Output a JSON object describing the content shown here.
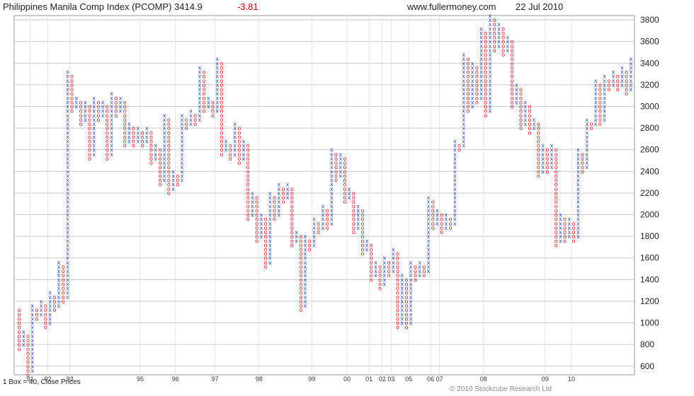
{
  "header": {
    "title": "Philippines Manila Comp Index (PCOMP) 3414.9",
    "change": "-3.81",
    "site": "www.fullermoney.com",
    "date": "22 Jul 2010"
  },
  "footer": {
    "box_info": "1 Box = 40, Close Prices",
    "copyright": "© 2010 Stockcube Research Ltd"
  },
  "colors": {
    "x_column": "#1f3fbf",
    "o_column": "#cc1111",
    "grid": "#c8c8c8"
  },
  "chart_data": {
    "type": "point-and-figure",
    "box_size": 40,
    "ylim": [
      520,
      3840
    ],
    "yticks": [
      600,
      800,
      1000,
      1200,
      1400,
      1600,
      1800,
      2000,
      2200,
      2400,
      2600,
      2800,
      3000,
      3200,
      3400,
      3600,
      3800
    ],
    "grid": true,
    "x_year_labels": [
      {
        "label": "91",
        "col": 3
      },
      {
        "label": "92",
        "col": 7
      },
      {
        "label": "93",
        "col": 12
      },
      {
        "label": "95",
        "col": 28
      },
      {
        "label": "96",
        "col": 36
      },
      {
        "label": "97",
        "col": 45
      },
      {
        "label": "98",
        "col": 55
      },
      {
        "label": "99",
        "col": 67
      },
      {
        "label": "00",
        "col": 75
      },
      {
        "label": "01",
        "col": 80
      },
      {
        "label": "02",
        "col": 83
      },
      {
        "label": "03",
        "col": 85
      },
      {
        "label": "05",
        "col": 89
      },
      {
        "label": "06",
        "col": 94
      },
      {
        "label": "07",
        "col": 96
      },
      {
        "label": "08",
        "col": 106
      },
      {
        "label": "09",
        "col": 120
      },
      {
        "label": "10",
        "col": 126
      }
    ],
    "columns": [
      {
        "t": "O",
        "from": 1120,
        "to": 760
      },
      {
        "t": "X",
        "from": 800,
        "to": 920
      },
      {
        "t": "O",
        "from": 880,
        "to": 520
      },
      {
        "t": "X",
        "from": 560,
        "to": 1160
      },
      {
        "t": "O",
        "from": 1120,
        "to": 1040
      },
      {
        "t": "X",
        "from": 1080,
        "to": 1200
      },
      {
        "t": "O",
        "from": 1160,
        "to": 960
      },
      {
        "t": "X",
        "from": 1000,
        "to": 1280
      },
      {
        "t": "O",
        "from": 1240,
        "to": 1120
      },
      {
        "t": "X",
        "from": 1160,
        "to": 1560
      },
      {
        "t": "O",
        "from": 1520,
        "to": 1200
      },
      {
        "t": "X",
        "from": 1240,
        "to": 3320
      },
      {
        "t": "O",
        "from": 3280,
        "to": 2960
      },
      {
        "t": "X",
        "from": 3000,
        "to": 3080
      },
      {
        "t": "O",
        "from": 3040,
        "to": 2840
      },
      {
        "t": "X",
        "from": 2880,
        "to": 3040
      },
      {
        "t": "O",
        "from": 3000,
        "to": 2520
      },
      {
        "t": "X",
        "from": 2560,
        "to": 3080
      },
      {
        "t": "O",
        "from": 3040,
        "to": 2880
      },
      {
        "t": "X",
        "from": 2920,
        "to": 3040
      },
      {
        "t": "O",
        "from": 3000,
        "to": 2520
      },
      {
        "t": "X",
        "from": 2560,
        "to": 3120
      },
      {
        "t": "O",
        "from": 3080,
        "to": 2920
      },
      {
        "t": "X",
        "from": 2960,
        "to": 3080
      },
      {
        "t": "O",
        "from": 3040,
        "to": 2640
      },
      {
        "t": "X",
        "from": 2680,
        "to": 2840
      },
      {
        "t": "O",
        "from": 2800,
        "to": 2640
      },
      {
        "t": "X",
        "from": 2680,
        "to": 2800
      },
      {
        "t": "O",
        "from": 2760,
        "to": 2640
      },
      {
        "t": "X",
        "from": 2680,
        "to": 2800
      },
      {
        "t": "O",
        "from": 2760,
        "to": 2480
      },
      {
        "t": "X",
        "from": 2520,
        "to": 2640
      },
      {
        "t": "O",
        "from": 2600,
        "to": 2280
      },
      {
        "t": "X",
        "from": 2320,
        "to": 2920
      },
      {
        "t": "O",
        "from": 2880,
        "to": 2200
      },
      {
        "t": "X",
        "from": 2240,
        "to": 2400
      },
      {
        "t": "O",
        "from": 2360,
        "to": 2280
      },
      {
        "t": "X",
        "from": 2320,
        "to": 2920
      },
      {
        "t": "O",
        "from": 2880,
        "to": 2800
      },
      {
        "t": "X",
        "from": 2840,
        "to": 2960
      },
      {
        "t": "O",
        "from": 2920,
        "to": 2840
      },
      {
        "t": "X",
        "from": 2880,
        "to": 3360
      },
      {
        "t": "O",
        "from": 3320,
        "to": 2960
      },
      {
        "t": "X",
        "from": 3000,
        "to": 3080
      },
      {
        "t": "O",
        "from": 3040,
        "to": 2920
      },
      {
        "t": "X",
        "from": 2960,
        "to": 3440
      },
      {
        "t": "O",
        "from": 3400,
        "to": 2560
      },
      {
        "t": "X",
        "from": 2600,
        "to": 2680
      },
      {
        "t": "O",
        "from": 2640,
        "to": 2520
      },
      {
        "t": "X",
        "from": 2560,
        "to": 2840
      },
      {
        "t": "O",
        "from": 2800,
        "to": 2480
      },
      {
        "t": "X",
        "from": 2520,
        "to": 2680
      },
      {
        "t": "O",
        "from": 2640,
        "to": 1960
      },
      {
        "t": "X",
        "from": 2000,
        "to": 2200
      },
      {
        "t": "O",
        "from": 2160,
        "to": 1760
      },
      {
        "t": "X",
        "from": 1800,
        "to": 2000
      },
      {
        "t": "O",
        "from": 1960,
        "to": 1520
      },
      {
        "t": "X",
        "from": 1560,
        "to": 2200
      },
      {
        "t": "O",
        "from": 2160,
        "to": 1960
      },
      {
        "t": "X",
        "from": 2000,
        "to": 2280
      },
      {
        "t": "O",
        "from": 2240,
        "to": 2120
      },
      {
        "t": "X",
        "from": 2160,
        "to": 2280
      },
      {
        "t": "O",
        "from": 2240,
        "to": 1720
      },
      {
        "t": "X",
        "from": 1760,
        "to": 1840
      },
      {
        "t": "O",
        "from": 1800,
        "to": 1120
      },
      {
        "t": "X",
        "from": 1160,
        "to": 1800
      },
      {
        "t": "O",
        "from": 1760,
        "to": 1680
      },
      {
        "t": "X",
        "from": 1720,
        "to": 1960
      },
      {
        "t": "O",
        "from": 1920,
        "to": 1840
      },
      {
        "t": "X",
        "from": 1880,
        "to": 2080
      },
      {
        "t": "O",
        "from": 2040,
        "to": 1880
      },
      {
        "t": "X",
        "from": 1920,
        "to": 2600
      },
      {
        "t": "O",
        "from": 2560,
        "to": 2320
      },
      {
        "t": "X",
        "from": 2360,
        "to": 2560
      },
      {
        "t": "O",
        "from": 2520,
        "to": 2120
      },
      {
        "t": "X",
        "from": 2160,
        "to": 2240
      },
      {
        "t": "O",
        "from": 2200,
        "to": 1840
      },
      {
        "t": "X",
        "from": 1880,
        "to": 2080
      },
      {
        "t": "O",
        "from": 2040,
        "to": 1640
      },
      {
        "t": "X",
        "from": 1680,
        "to": 1760
      },
      {
        "t": "O",
        "from": 1720,
        "to": 1400
      },
      {
        "t": "X",
        "from": 1440,
        "to": 1560
      },
      {
        "t": "O",
        "from": 1520,
        "to": 1320
      },
      {
        "t": "X",
        "from": 1360,
        "to": 1600
      },
      {
        "t": "O",
        "from": 1560,
        "to": 1440
      },
      {
        "t": "X",
        "from": 1480,
        "to": 1680
      },
      {
        "t": "O",
        "from": 1640,
        "to": 960
      },
      {
        "t": "X",
        "from": 1000,
        "to": 1440
      },
      {
        "t": "O",
        "from": 1400,
        "to": 960
      },
      {
        "t": "X",
        "from": 1000,
        "to": 1560
      },
      {
        "t": "O",
        "from": 1520,
        "to": 1400
      },
      {
        "t": "X",
        "from": 1440,
        "to": 1560
      },
      {
        "t": "O",
        "from": 1520,
        "to": 1440
      },
      {
        "t": "X",
        "from": 1480,
        "to": 2160
      },
      {
        "t": "O",
        "from": 2120,
        "to": 1880
      },
      {
        "t": "X",
        "from": 1920,
        "to": 2040
      },
      {
        "t": "O",
        "from": 2000,
        "to": 1840
      },
      {
        "t": "X",
        "from": 1880,
        "to": 2000
      },
      {
        "t": "O",
        "from": 1960,
        "to": 1880
      },
      {
        "t": "X",
        "from": 1920,
        "to": 2680
      },
      {
        "t": "O",
        "from": 2640,
        "to": 2600
      },
      {
        "t": "X",
        "from": 2640,
        "to": 3480
      },
      {
        "t": "O",
        "from": 3440,
        "to": 2960
      },
      {
        "t": "X",
        "from": 3000,
        "to": 3400
      },
      {
        "t": "O",
        "from": 3360,
        "to": 3040
      },
      {
        "t": "X",
        "from": 3080,
        "to": 3720
      },
      {
        "t": "O",
        "from": 3680,
        "to": 2920
      },
      {
        "t": "X",
        "from": 2960,
        "to": 3840
      },
      {
        "t": "O",
        "from": 3800,
        "to": 3520
      },
      {
        "t": "X",
        "from": 3560,
        "to": 3760
      },
      {
        "t": "O",
        "from": 3720,
        "to": 3480
      },
      {
        "t": "X",
        "from": 3520,
        "to": 3640
      },
      {
        "t": "O",
        "from": 3600,
        "to": 3000
      },
      {
        "t": "X",
        "from": 3040,
        "to": 3200
      },
      {
        "t": "O",
        "from": 3160,
        "to": 2800
      },
      {
        "t": "X",
        "from": 2840,
        "to": 3040
      },
      {
        "t": "O",
        "from": 3000,
        "to": 2760
      },
      {
        "t": "X",
        "from": 2800,
        "to": 2880
      },
      {
        "t": "O",
        "from": 2840,
        "to": 2360
      },
      {
        "t": "X",
        "from": 2400,
        "to": 2640
      },
      {
        "t": "O",
        "from": 2600,
        "to": 2400
      },
      {
        "t": "X",
        "from": 2440,
        "to": 2640
      },
      {
        "t": "O",
        "from": 2600,
        "to": 1720
      },
      {
        "t": "X",
        "from": 1760,
        "to": 2000
      },
      {
        "t": "O",
        "from": 1960,
        "to": 1760
      },
      {
        "t": "X",
        "from": 1800,
        "to": 1960
      },
      {
        "t": "O",
        "from": 1920,
        "to": 1760
      },
      {
        "t": "X",
        "from": 1800,
        "to": 2600
      },
      {
        "t": "O",
        "from": 2560,
        "to": 2400
      },
      {
        "t": "X",
        "from": 2440,
        "to": 2880
      },
      {
        "t": "O",
        "from": 2840,
        "to": 2800
      },
      {
        "t": "X",
        "from": 2840,
        "to": 3240
      },
      {
        "t": "O",
        "from": 3200,
        "to": 2840
      },
      {
        "t": "X",
        "from": 2880,
        "to": 3280
      },
      {
        "t": "O",
        "from": 3240,
        "to": 3160
      },
      {
        "t": "X",
        "from": 3200,
        "to": 3320
      },
      {
        "t": "O",
        "from": 3280,
        "to": 3160
      },
      {
        "t": "X",
        "from": 3200,
        "to": 3360
      },
      {
        "t": "O",
        "from": 3320,
        "to": 3120
      },
      {
        "t": "X",
        "from": 3160,
        "to": 3440
      }
    ]
  }
}
